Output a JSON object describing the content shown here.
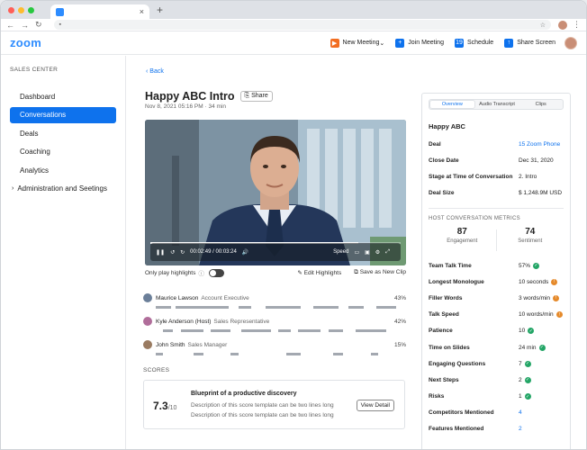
{
  "browser": {
    "tab_label": "",
    "close_glyph": "×",
    "new_tab_glyph": "+",
    "lock_glyph": "▪",
    "star_glyph": "☆",
    "menu_glyph": "⋮"
  },
  "header": {
    "logo": "zoom",
    "actions": [
      {
        "label": "New Meeting",
        "icon": "video-icon",
        "color": "#f26d21"
      },
      {
        "label": "Join Meeting",
        "icon": "plus-icon",
        "color": "#0e72ed"
      },
      {
        "label": "Schedule",
        "icon": "calendar-icon",
        "color": "#0e72ed"
      },
      {
        "label": "Share Screen",
        "icon": "share-screen-icon",
        "color": "#0e72ed"
      }
    ]
  },
  "sidebar": {
    "title": "SALES CENTER",
    "items": [
      {
        "label": "Dashboard"
      },
      {
        "label": "Conversations",
        "active": true
      },
      {
        "label": "Deals"
      },
      {
        "label": "Coaching"
      },
      {
        "label": "Analytics"
      },
      {
        "label": "Administration and Seetings",
        "expandable": true
      }
    ]
  },
  "main": {
    "back_label": "Back",
    "title": "Happy ABC Intro",
    "share_label": "Share",
    "subtitle": "Nov 8, 2021 05:16 PM · 34 min",
    "player": {
      "time": "00:02:49 / 00:03:24",
      "speed_label": "Speed",
      "progress": 0.83
    },
    "highlights_label": "Only play highlights",
    "edit_highlights": "Edit Highlights",
    "save_clip": "Save as New Clip",
    "speakers": [
      {
        "name": "Maurice Lawson",
        "role": "Account Executive",
        "pct": "43%",
        "color": "#6b7f99"
      },
      {
        "name": "Kyle Anderson (Host)",
        "role": "Sales Representative",
        "pct": "42%",
        "color": "#b06d9a"
      },
      {
        "name": "John Smith",
        "role": "Sales Manager",
        "pct": "15%",
        "color": "#9a7b61"
      }
    ],
    "scores_heading": "SCORES",
    "score": {
      "value": "7.3",
      "out_of": "/10",
      "title": "Blueprint of a productive discovery",
      "desc1": "Description of this score template can be two lines long",
      "desc2": "Description of this score template can be two lines long",
      "button": "View Detail"
    }
  },
  "panel": {
    "tabs": [
      "Overview",
      "Audio Transcript",
      "Clips"
    ],
    "name": "Happy ABC",
    "fields": [
      {
        "k": "Deal",
        "v": "15 Zoom Phone",
        "link": true
      },
      {
        "k": "Close Date",
        "v": "Dec 31, 2020"
      },
      {
        "k": "Stage at Time of Conversation",
        "v": "2. Intro"
      },
      {
        "k": "Deal Size",
        "v": "$ 1,248.9M USD"
      }
    ],
    "metrics_heading": "HOST CONVERSATION METRICS",
    "engagement": {
      "value": "87",
      "label": "Engagement"
    },
    "sentiment": {
      "value": "74",
      "label": "Sentiment"
    },
    "metrics": [
      {
        "k": "Team Talk Time",
        "v": "57%",
        "status": "good"
      },
      {
        "k": "Longest Monologue",
        "v": "10 seconds",
        "status": "warn"
      },
      {
        "k": "Filler Words",
        "v": "3 words/min",
        "status": "warn"
      },
      {
        "k": "Talk Speed",
        "v": "10 words/min",
        "status": "warn"
      },
      {
        "k": "Patience",
        "v": "10",
        "status": "good"
      },
      {
        "k": "Time on Slides",
        "v": "24 min",
        "status": "good"
      },
      {
        "k": "Engaging Questions",
        "v": "7",
        "status": "good"
      },
      {
        "k": "Next Steps",
        "v": "2",
        "status": "good"
      },
      {
        "k": "Risks",
        "v": "1",
        "status": "good"
      },
      {
        "k": "Competitors Mentioned",
        "v": "4",
        "link": true
      },
      {
        "k": "Features Mentioned",
        "v": "2",
        "link": true
      }
    ],
    "status_colors": {
      "good": "#23a566",
      "warn": "#e58a2b"
    }
  }
}
